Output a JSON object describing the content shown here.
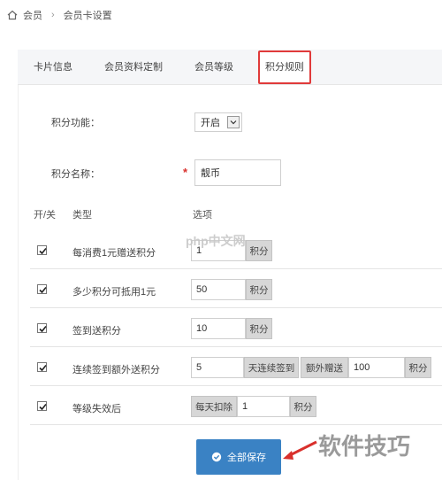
{
  "breadcrumb": {
    "home": "会员",
    "current": "会员卡设置"
  },
  "tabs": [
    {
      "label": "卡片信息"
    },
    {
      "label": "会员资料定制"
    },
    {
      "label": "会员等级"
    },
    {
      "label": "积分规则",
      "active": true
    }
  ],
  "form": {
    "points_function": {
      "label": "积分功能：",
      "value": "开启"
    },
    "points_name": {
      "label": "积分名称：",
      "required": "*",
      "value": "靓币"
    }
  },
  "table": {
    "headers": {
      "toggle": "开/关",
      "type": "类型",
      "options": "选项"
    },
    "rows": [
      {
        "label": "每消费1元赠送积分",
        "value": "1",
        "addon": "积分"
      },
      {
        "label": "多少积分可抵用1元",
        "value": "50",
        "addon": "积分"
      },
      {
        "label": "签到送积分",
        "value": "10",
        "addon": "积分"
      },
      {
        "label": "连续签到额外送积分",
        "value": "5",
        "addon": "天连续签到",
        "addon2": "额外赠送",
        "value2": "100",
        "addon3": "积分"
      },
      {
        "label": "等级失效后",
        "prefix": "每天扣除",
        "value": "1",
        "addon": "积分"
      }
    ]
  },
  "save_button": {
    "label": "全部保存"
  },
  "watermarks": {
    "php": "php中文网",
    "corner": "软件技巧"
  },
  "colors": {
    "accent_red": "#e03a3a",
    "button_blue": "#3a82c4"
  }
}
